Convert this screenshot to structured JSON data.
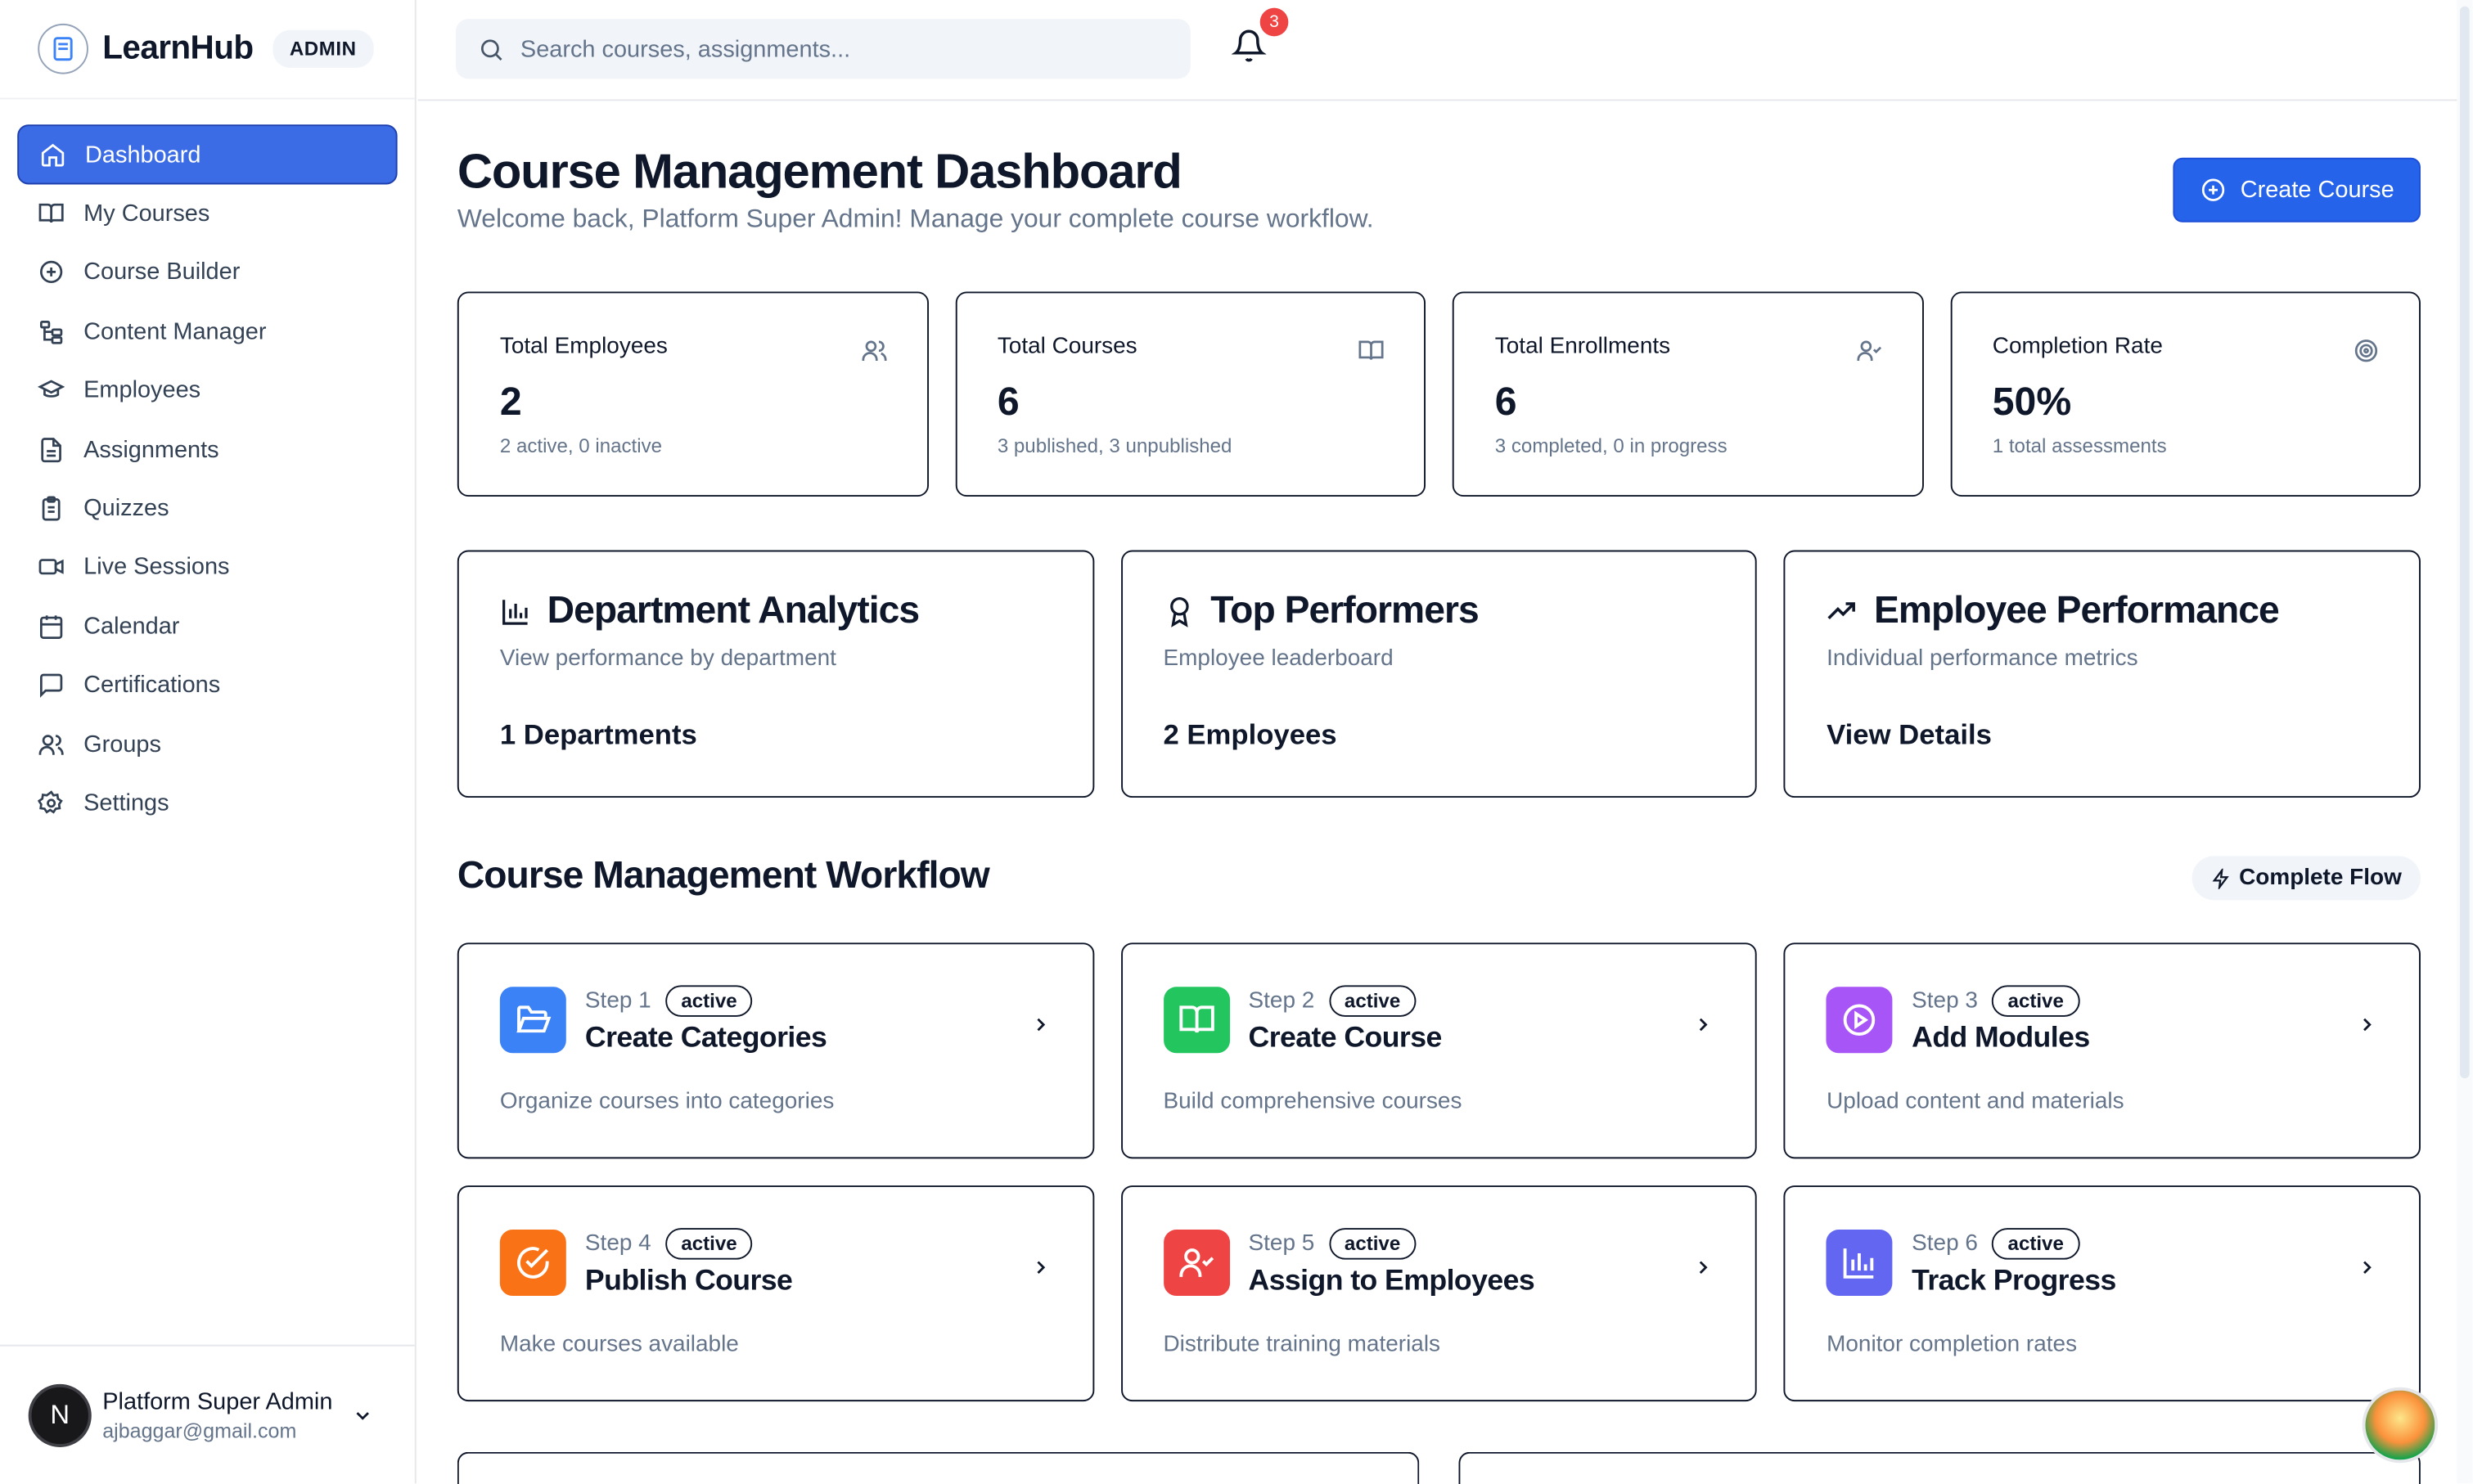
{
  "brand": {
    "name": "LearnHub",
    "badge": "ADMIN"
  },
  "sidebar": {
    "items": [
      {
        "label": "Dashboard",
        "icon": "home-icon",
        "active": true
      },
      {
        "label": "My Courses",
        "icon": "book-open-icon"
      },
      {
        "label": "Course Builder",
        "icon": "plus-circle-icon"
      },
      {
        "label": "Content Manager",
        "icon": "folder-tree-icon"
      },
      {
        "label": "Employees",
        "icon": "graduation-cap-icon"
      },
      {
        "label": "Assignments",
        "icon": "file-text-icon"
      },
      {
        "label": "Quizzes",
        "icon": "clipboard-icon"
      },
      {
        "label": "Live Sessions",
        "icon": "video-icon"
      },
      {
        "label": "Calendar",
        "icon": "calendar-icon"
      },
      {
        "label": "Certifications",
        "icon": "message-square-icon"
      },
      {
        "label": "Groups",
        "icon": "users-icon"
      },
      {
        "label": "Settings",
        "icon": "gear-icon"
      }
    ]
  },
  "user": {
    "initial": "N",
    "name": "Platform Super Admin",
    "email": "ajbaggar@gmail.com"
  },
  "search": {
    "placeholder": "Search courses, assignments...",
    "value": ""
  },
  "notifications": {
    "count": "3"
  },
  "header": {
    "title": "Course Management Dashboard",
    "subtitle": "Welcome back, Platform Super Admin! Manage your complete course workflow.",
    "create_label": "Create Course"
  },
  "stats": [
    {
      "label": "Total Employees",
      "value": "2",
      "sub": "2 active, 0 inactive",
      "icon": "users-icon"
    },
    {
      "label": "Total Courses",
      "value": "6",
      "sub": "3 published, 3 unpublished",
      "icon": "book-open-icon"
    },
    {
      "label": "Total Enrollments",
      "value": "6",
      "sub": "3 completed, 0 in progress",
      "icon": "user-check-icon"
    },
    {
      "label": "Completion Rate",
      "value": "50%",
      "sub": "1 total assessments",
      "icon": "target-icon"
    }
  ],
  "analytics": [
    {
      "title": "Department Analytics",
      "sub": "View performance by department",
      "value": "1 Departments",
      "icon": "bar-chart-icon"
    },
    {
      "title": "Top Performers",
      "sub": "Employee leaderboard",
      "value": "2 Employees",
      "icon": "award-icon"
    },
    {
      "title": "Employee Performance",
      "sub": "Individual performance metrics",
      "value": "View Details",
      "icon": "trending-up-icon"
    }
  ],
  "workflow": {
    "title": "Course Management Workflow",
    "badge": "Complete Flow",
    "steps": [
      {
        "step": "Step 1",
        "status": "active",
        "name": "Create Categories",
        "desc": "Organize courses into categories",
        "color": "#3b82f6",
        "icon": "folder-open-icon"
      },
      {
        "step": "Step 2",
        "status": "active",
        "name": "Create Course",
        "desc": "Build comprehensive courses",
        "color": "#22c55e",
        "icon": "book-open-icon"
      },
      {
        "step": "Step 3",
        "status": "active",
        "name": "Add Modules",
        "desc": "Upload content and materials",
        "color": "#a855f7",
        "icon": "play-circle-icon"
      },
      {
        "step": "Step 4",
        "status": "active",
        "name": "Publish Course",
        "desc": "Make courses available",
        "color": "#f97316",
        "icon": "check-circle-icon"
      },
      {
        "step": "Step 5",
        "status": "active",
        "name": "Assign to Employees",
        "desc": "Distribute training materials",
        "color": "#ef4444",
        "icon": "user-check-icon"
      },
      {
        "step": "Step 6",
        "status": "active",
        "name": "Track Progress",
        "desc": "Monitor completion rates",
        "color": "#6366f1",
        "icon": "bar-chart-icon"
      }
    ]
  }
}
